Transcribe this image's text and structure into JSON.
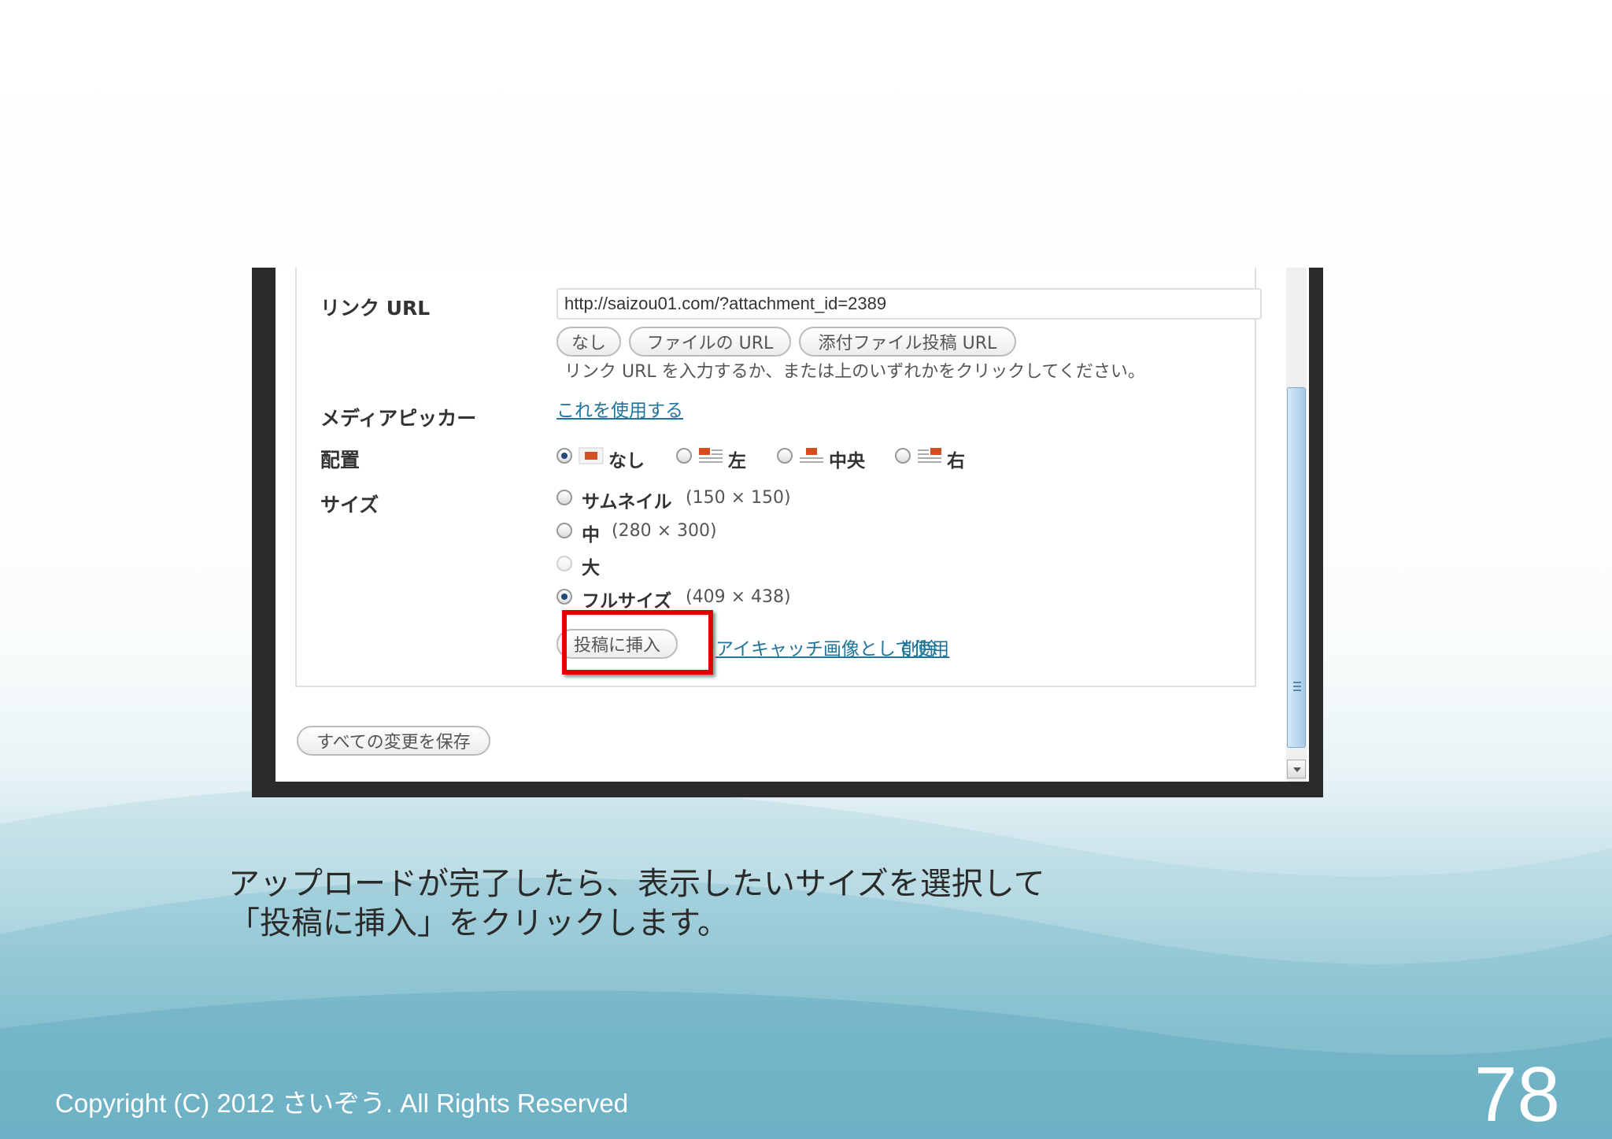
{
  "form": {
    "link_url_label": "リンク URL",
    "link_url_value": "http://saizou01.com/?attachment_id=2389",
    "link_buttons": [
      "なし",
      "ファイルの URL",
      "添付ファイル投稿 URL"
    ],
    "link_help": "リンク URL を入力するか、または上のいずれかをクリックしてください。",
    "media_picker_label": "メディアピッカー",
    "media_picker_link": "これを使用する",
    "alignment_label": "配置",
    "alignment_options": [
      {
        "label": "なし",
        "selected": true,
        "icon": "align-none-icon"
      },
      {
        "label": "左",
        "selected": false,
        "icon": "align-left-icon"
      },
      {
        "label": "中央",
        "selected": false,
        "icon": "align-center-icon"
      },
      {
        "label": "右",
        "selected": false,
        "icon": "align-right-icon"
      }
    ],
    "size_label": "サイズ",
    "size_options": [
      {
        "label": "サムネイル",
        "dims": "(150 × 150)",
        "selected": false,
        "disabled": false
      },
      {
        "label": "中",
        "dims": "(280 × 300)",
        "selected": false,
        "disabled": false
      },
      {
        "label": "大",
        "dims": "",
        "selected": false,
        "disabled": true
      },
      {
        "label": "フルサイズ",
        "dims": "(409 × 438)",
        "selected": true,
        "disabled": false
      }
    ],
    "insert_button": "投稿に挿入",
    "featured_image_link": "アイキャッチ画像として使用",
    "delete_link": "削除",
    "save_all_button": "すべての変更を保存"
  },
  "caption": {
    "line1": "アップロードが完了したら、表示したいサイズを選択して",
    "line2": "「投稿に挿入」をクリックします。"
  },
  "footer": {
    "copyright": "Copyright (C) 2012 さいぞう. All Rights Reserved",
    "page_number": "78"
  },
  "colors": {
    "highlight": "#e00000",
    "link": "#21759b",
    "radio_selected": "#214a7a",
    "align_icon_accent": "#d54e21"
  }
}
